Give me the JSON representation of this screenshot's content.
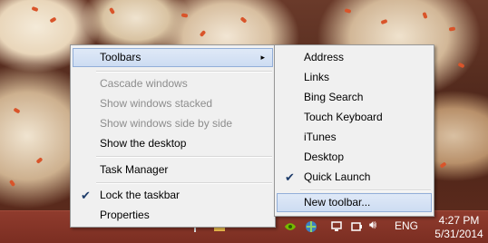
{
  "context_menu": {
    "items": [
      {
        "label": "Toolbars"
      },
      {
        "label": "Cascade windows"
      },
      {
        "label": "Show windows stacked"
      },
      {
        "label": "Show windows side by side"
      },
      {
        "label": "Show the desktop"
      },
      {
        "label": "Task Manager"
      },
      {
        "label": "Lock the taskbar"
      },
      {
        "label": "Properties"
      }
    ],
    "submenu_arrow": "▸",
    "check_mark": "✔"
  },
  "toolbars_submenu": {
    "items": [
      {
        "label": "Address"
      },
      {
        "label": "Links"
      },
      {
        "label": "Bing Search"
      },
      {
        "label": "Touch Keyboard"
      },
      {
        "label": "iTunes"
      },
      {
        "label": "Desktop"
      },
      {
        "label": "Quick Launch"
      },
      {
        "label": "New toolbar..."
      }
    ],
    "check_mark": "✔"
  },
  "taskbar": {
    "tray_icons": [
      "flag-icon",
      "folder-icon",
      "nvidia-icon",
      "network-share-icon",
      "network-icon",
      "power-icon",
      "volume-icon"
    ],
    "volume_glyph": "🔊︎",
    "language": "ENG",
    "time": "4:27 PM",
    "date": "5/31/2014",
    "colors": {
      "taskbar": "#8f3b2d",
      "highlight": "#cddcf2"
    }
  }
}
